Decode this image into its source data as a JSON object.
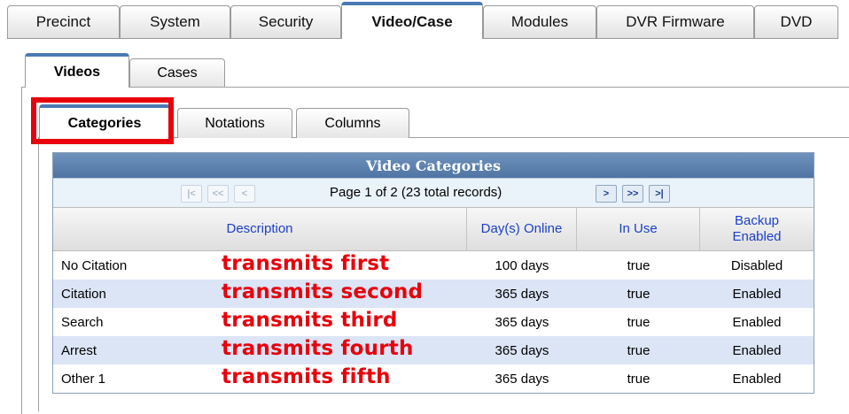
{
  "top_tabs": [
    {
      "label": "Precinct"
    },
    {
      "label": "System"
    },
    {
      "label": "Security"
    },
    {
      "label": "Video/Case",
      "active": true
    },
    {
      "label": "Modules"
    },
    {
      "label": "DVR Firmware"
    },
    {
      "label": "DVD"
    }
  ],
  "sub_tabs": [
    {
      "label": "Videos",
      "active": true
    },
    {
      "label": "Cases"
    }
  ],
  "category_tabs": [
    {
      "label": "Categories",
      "active": true
    },
    {
      "label": "Notations"
    },
    {
      "label": "Columns"
    }
  ],
  "grid": {
    "title": "Video Categories",
    "pager": {
      "text": "Page 1 of 2 (23 total records)",
      "first_icon": "first-page-icon",
      "prev_page_icon": "previous-page-icon",
      "prev_icon": "previous-icon",
      "next_icon": "next-icon",
      "next_page_icon": "next-page-icon",
      "last_icon": "last-page-icon"
    },
    "columns": [
      "Description",
      "Day(s) Online",
      "In Use",
      "Backup Enabled"
    ],
    "rows": [
      {
        "description": "No Citation",
        "note": "transmits first",
        "days": "100 days",
        "in_use": "true",
        "backup": "Disabled"
      },
      {
        "description": "Citation",
        "note": "transmits second",
        "days": "365 days",
        "in_use": "true",
        "backup": "Enabled"
      },
      {
        "description": "Search",
        "note": "transmits third",
        "days": "365 days",
        "in_use": "true",
        "backup": "Enabled"
      },
      {
        "description": "Arrest",
        "note": "transmits fourth",
        "days": "365 days",
        "in_use": "true",
        "backup": "Enabled"
      },
      {
        "description": "Other 1",
        "note": "transmits fifth",
        "days": "365 days",
        "in_use": "true",
        "backup": "Enabled"
      }
    ]
  },
  "colors": {
    "highlight": "#e8000b",
    "accent": "#4a7ab3",
    "header_text": "#1b41c7",
    "alt_row": "#dbe5f6"
  }
}
